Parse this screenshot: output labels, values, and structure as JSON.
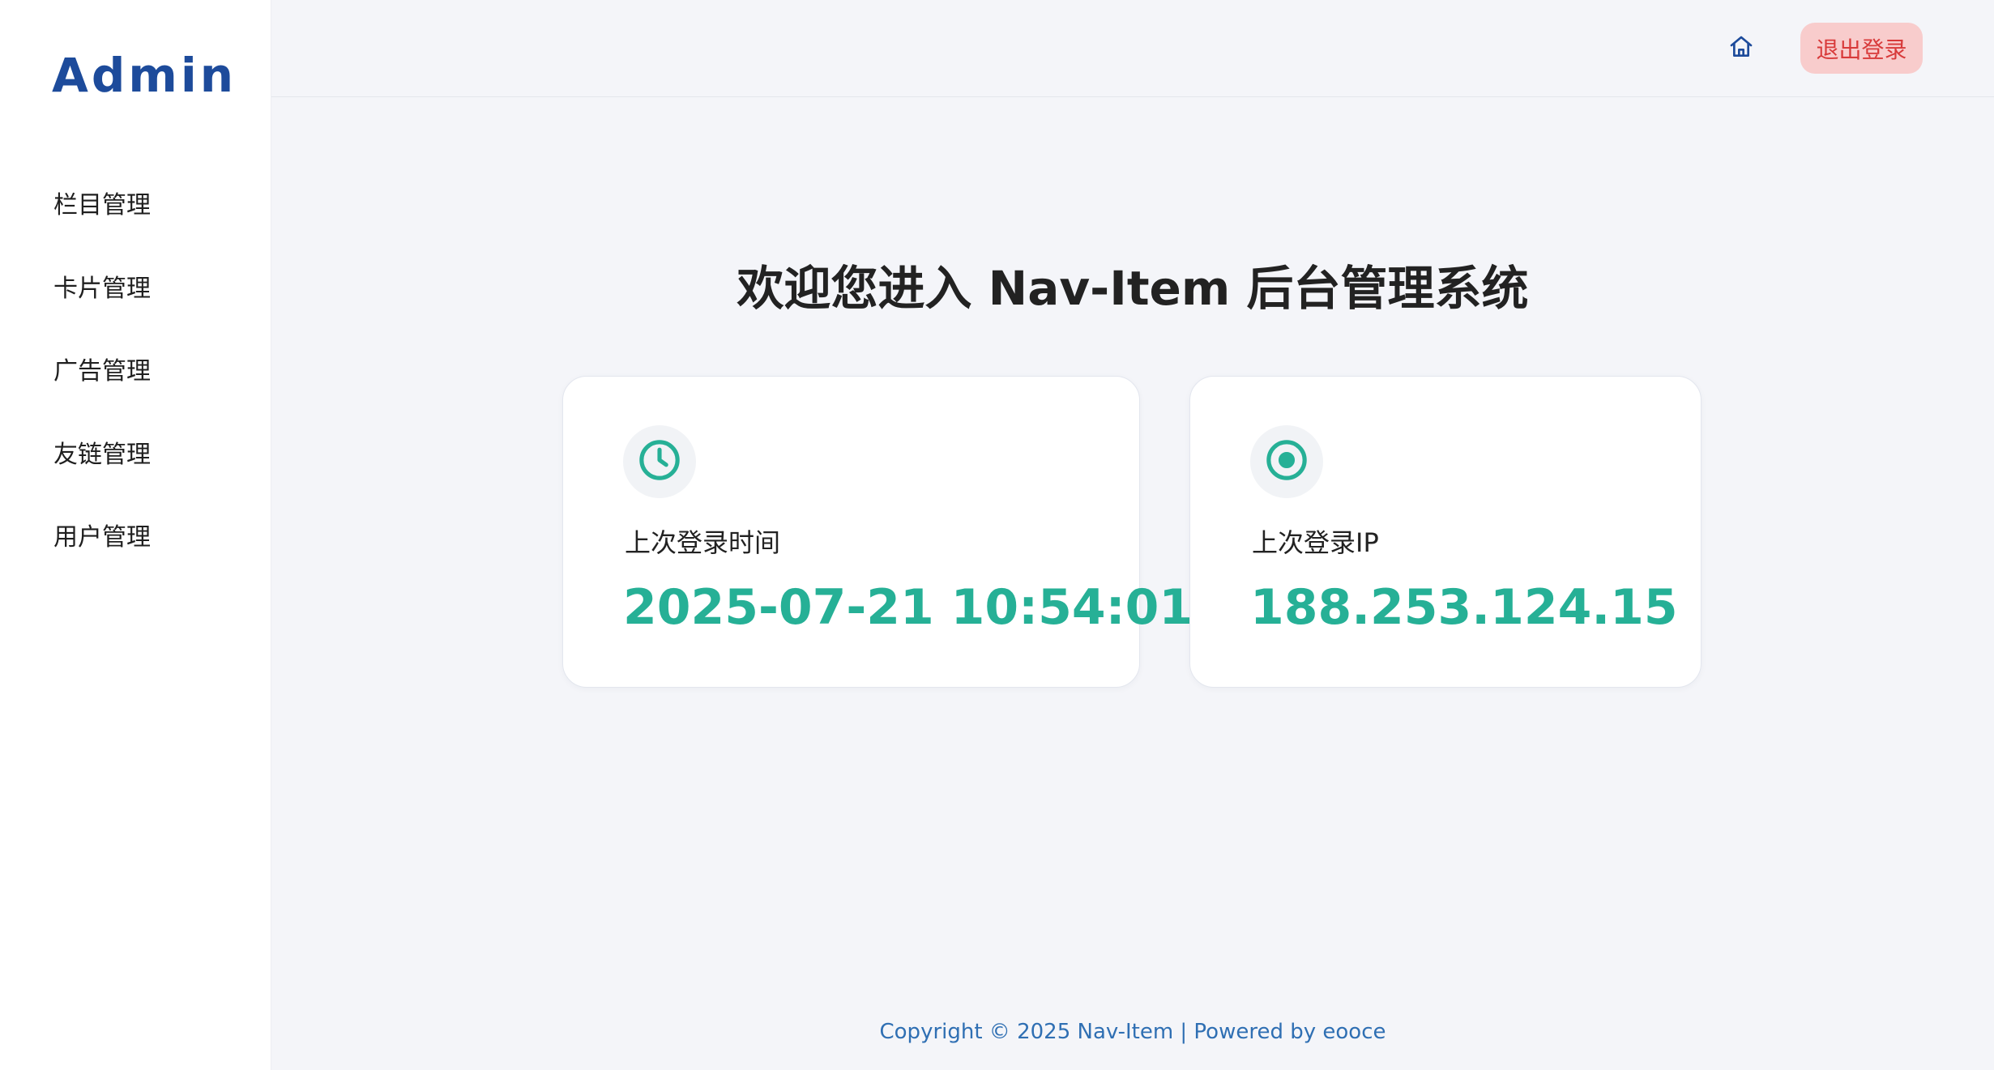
{
  "brand": "Admin",
  "sidebar": {
    "items": [
      {
        "label": "栏目管理"
      },
      {
        "label": "卡片管理"
      },
      {
        "label": "广告管理"
      },
      {
        "label": "友链管理"
      },
      {
        "label": "用户管理"
      }
    ]
  },
  "header": {
    "home_icon": "home-icon",
    "logout_label": "退出登录"
  },
  "main": {
    "welcome": "欢迎您进入 Nav-Item 后台管理系统",
    "cards": [
      {
        "icon": "clock-icon",
        "label": "上次登录时间",
        "value": "2025-07-21 10:54:01"
      },
      {
        "icon": "target-icon",
        "label": "上次登录IP",
        "value": "188.253.124.15"
      }
    ]
  },
  "footer": "Copyright © 2025 Nav-Item | Powered by eooce",
  "colors": {
    "brand": "#1d4b9b",
    "accent": "#26b096",
    "logout_bg": "#f8cccc",
    "logout_text": "#d83a3a",
    "footer_text": "#2f6fb3"
  }
}
